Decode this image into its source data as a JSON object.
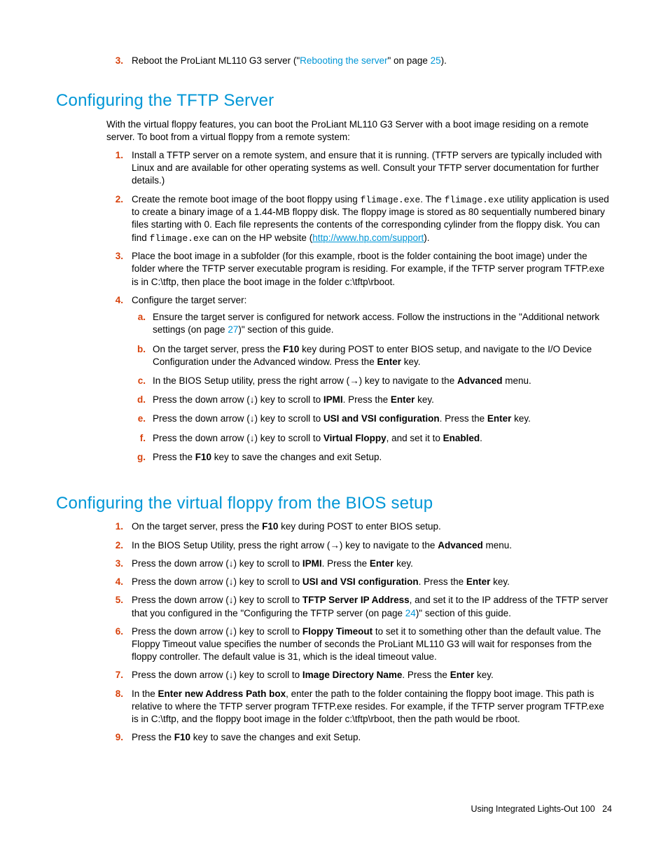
{
  "top_item": {
    "marker": "3.",
    "t1": "Reboot the ProLiant ML110 G3 server (\"",
    "link": "Rebooting the server",
    "t2": "\" on page ",
    "page": "25",
    "t3": ")."
  },
  "h1": "Configuring the TFTP Server",
  "intro1": "With the virtual floppy features, you can boot the ProLiant ML110 G3 Server with a boot image residing on a remote server. To boot from a virtual floppy from a remote system:",
  "s1_items": {
    "i1": {
      "m": "1.",
      "t": "Install a TFTP server on a remote system, and ensure that it is running. (TFTP servers are typically included with Linux and are available for other operating systems as well. Consult your TFTP server documentation for further details.)"
    },
    "i2": {
      "m": "2.",
      "t1": "Create the remote boot image of the boot floppy using ",
      "c1": "flimage.exe",
      "t2": ". The ",
      "c2": "flimage.exe",
      "t3": " utility application is used to create a binary image of a 1.44-MB floppy disk. The floppy image is stored as 80 sequentially numbered binary files starting with 0. Each file represents the contents of the corresponding cylinder from the floppy disk. You can find ",
      "c3": "flimage.exe",
      "t4": " can on the HP website (",
      "url": "http://www.hp.com/support",
      "t5": ")."
    },
    "i3": {
      "m": "3.",
      "t": "Place the boot image in a subfolder (for this example, rboot is the folder containing the boot image) under the folder where the TFTP server executable program is residing. For example, if the TFTP server program TFTP.exe is in C:\\tftp, then place the boot image in the folder c:\\tftp\\rboot."
    },
    "i4": {
      "m": "4.",
      "t": "Configure the target server:",
      "sub": {
        "a": {
          "m": "a.",
          "t1": "Ensure the target server is configured for network access. Follow the instructions in the \"Additional network settings (on page ",
          "page": "27",
          "t2": ")\" section of this guide."
        },
        "b": {
          "m": "b.",
          "t1": "On the target server, press the ",
          "b1": "F10",
          "t2": " key during POST to enter BIOS setup, and navigate to the I/O Device Configuration under the Advanced window. Press the ",
          "b2": "Enter",
          "t3": " key."
        },
        "c": {
          "m": "c.",
          "t1": "In the BIOS Setup utility, press the right arrow (→) key to navigate to the ",
          "b1": "Advanced",
          "t2": " menu."
        },
        "d": {
          "m": "d.",
          "t1": "Press the down arrow (↓) key to scroll to ",
          "b1": "IPMI",
          "t2": ". Press the ",
          "b2": "Enter",
          "t3": " key."
        },
        "e": {
          "m": "e.",
          "t1": "Press the down arrow (↓) key to scroll to ",
          "b1": "USI and VSI configuration",
          "t2": ". Press the ",
          "b2": "Enter",
          "t3": " key."
        },
        "f": {
          "m": "f.",
          "t1": "Press the down arrow (↓) key to scroll to ",
          "b1": "Virtual Floppy",
          "t2": ", and set it to ",
          "b2": "Enabled",
          "t3": "."
        },
        "g": {
          "m": "g.",
          "t1": "Press the ",
          "b1": "F10",
          "t2": " key to save the changes and exit Setup."
        }
      }
    }
  },
  "h2": "Configuring the virtual floppy from the BIOS setup",
  "s2_items": {
    "i1": {
      "m": "1.",
      "t1": "On the target server, press the ",
      "b1": "F10",
      "t2": " key during POST to enter BIOS setup."
    },
    "i2": {
      "m": "2.",
      "t1": "In the BIOS Setup Utility, press the right arrow (→) key to navigate to the ",
      "b1": "Advanced",
      "t2": " menu."
    },
    "i3": {
      "m": "3.",
      "t1": "Press the down arrow (↓) key to scroll to ",
      "b1": "IPMI",
      "t2": ". Press the ",
      "b2": "Enter",
      "t3": " key."
    },
    "i4": {
      "m": "4.",
      "t1": "Press the down arrow (↓) key to scroll to ",
      "b1": "USI and VSI configuration",
      "t2": ". Press the ",
      "b2": "Enter",
      "t3": " key."
    },
    "i5": {
      "m": "5.",
      "t1": "Press the down arrow (↓) key to scroll to ",
      "b1": "TFTP Server IP Address",
      "t2": ", and set it to the IP address of the TFTP server that you configured in the \"Configuring the TFTP server (on page ",
      "page": "24",
      "t3": ")\" section of this guide."
    },
    "i6": {
      "m": "6.",
      "t1": "Press the down arrow (↓) key to scroll to ",
      "b1": "Floppy Timeout",
      "t2": " to set it to something other than the default value. The Floppy Timeout value specifies the number of seconds the ProLiant ML110 G3 will wait for responses from the floppy controller. The default value is 31, which is the ideal timeout value."
    },
    "i7": {
      "m": "7.",
      "t1": "Press the down arrow (↓) key to scroll to ",
      "b1": "Image Directory Name",
      "t2": ". Press the ",
      "b2": "Enter",
      "t3": " key."
    },
    "i8": {
      "m": "8.",
      "t1": "In the ",
      "b1": "Enter new Address Path box",
      "t2": ", enter the path to the folder containing the floppy boot image. This path is relative to where the TFTP server program TFTP.exe resides. For example, if the TFTP server program TFTP.exe is in C:\\tftp, and the floppy boot image in the folder c:\\tftp\\rboot, then the path would be rboot."
    },
    "i9": {
      "m": "9.",
      "t1": "Press the ",
      "b1": "F10",
      "t2": " key to save the changes and exit Setup."
    }
  },
  "footer": {
    "text": "Using Integrated Lights-Out 100",
    "page": "24"
  }
}
